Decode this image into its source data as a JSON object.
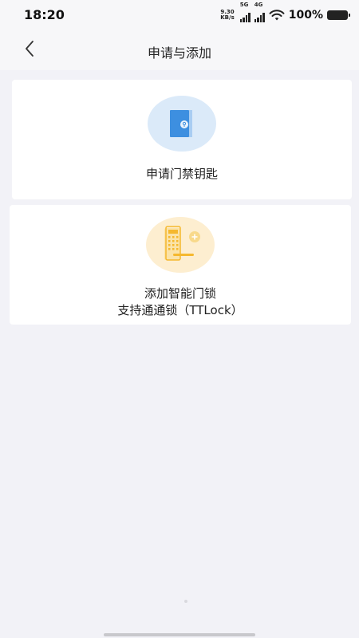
{
  "status_bar": {
    "time": "18:20",
    "net_speed_value": "9.30",
    "net_speed_unit": "KB/s",
    "signal_1_label": "5G",
    "signal_2_label": "4G",
    "battery_percent": "100%"
  },
  "header": {
    "back_icon": "chevron-left-icon",
    "title": "申请与添加"
  },
  "cards": [
    {
      "icon": "door-key-icon",
      "label": "申请门禁钥匙",
      "accent": "#3d8fe0"
    },
    {
      "icon": "smart-lock-add-icon",
      "label_line1": "添加智能门锁",
      "label_line2": "支持通通锁（TTLock）",
      "accent": "#f5b82e"
    }
  ]
}
